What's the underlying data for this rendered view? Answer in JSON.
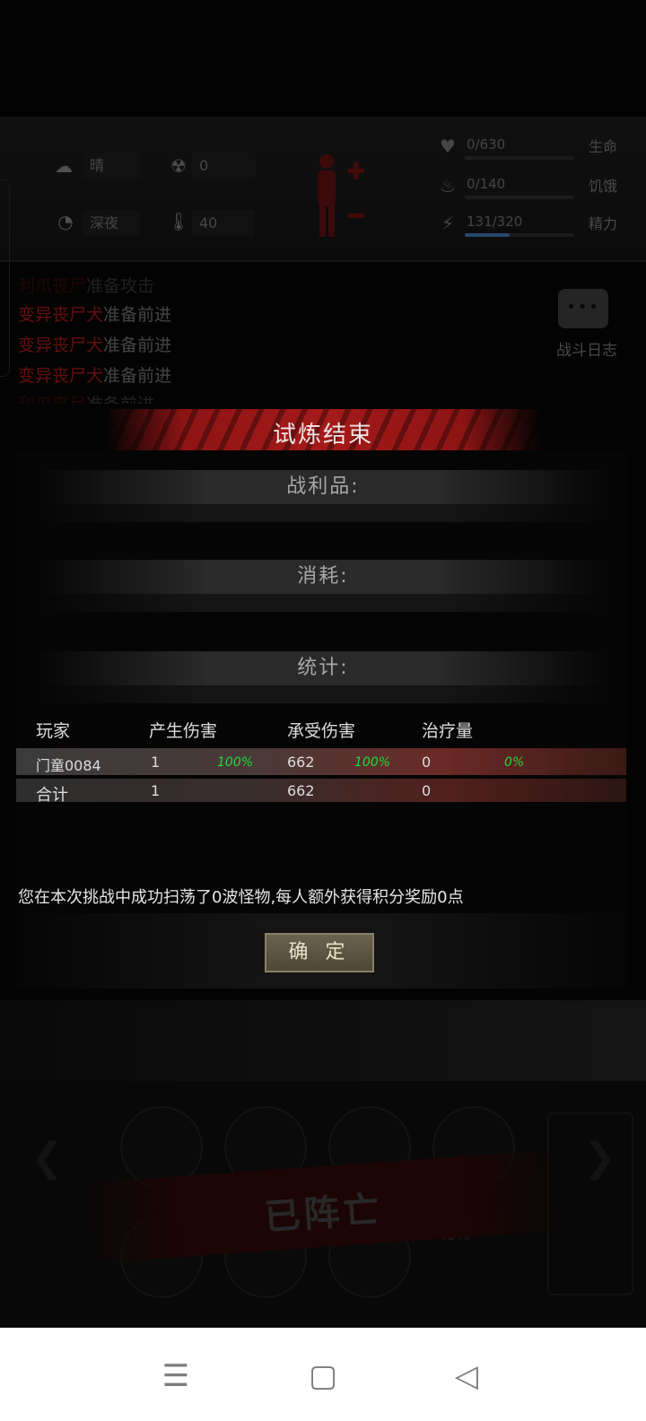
{
  "hud": {
    "weather": "晴",
    "radiation": "0",
    "time_of_day": "深夜",
    "temperature": "40",
    "stats": [
      {
        "value": "0/630",
        "label": "生命",
        "fill": 0
      },
      {
        "value": "0/140",
        "label": "饥饿",
        "fill": 0
      },
      {
        "value": "131/320",
        "label": "精力",
        "fill": 0.41
      }
    ]
  },
  "battle_log": {
    "lines": [
      {
        "name": "利爪丧尸",
        "text": "准备攻击"
      },
      {
        "name": "变异丧尸犬",
        "text": "准备前进"
      },
      {
        "name": "变异丧尸犬",
        "text": "准备前进"
      },
      {
        "name": "变异丧尸犬",
        "text": "准备前进"
      },
      {
        "name": "利爪丧尸",
        "text": "准备前进"
      }
    ],
    "button_label": "战斗日志"
  },
  "dialog": {
    "title": "试炼结束",
    "loot_label": "战利品:",
    "consume_label": "消耗:",
    "stats_label": "统计:",
    "table": {
      "headers": [
        "玩家",
        "产生伤害",
        "承受伤害",
        "治疗量"
      ],
      "rows": [
        {
          "player": "门童0084",
          "dmg": "1",
          "dmg_pct": "100%",
          "taken": "662",
          "taken_pct": "100%",
          "heal": "0",
          "heal_pct": "0%"
        },
        {
          "player": "合计",
          "dmg": "1",
          "taken": "662",
          "heal": "0"
        }
      ]
    },
    "notice": "您在本次挑战中成功扫荡了0波怪物,每人额外获得积分奖励0点",
    "confirm_label": "确 定"
  },
  "background": {
    "dead_banner": "已阵亡",
    "percent": "43%"
  },
  "navbar": {
    "menu": "☰",
    "home": "▢",
    "back": "◁"
  },
  "colors": {
    "accent_red": "#a51a1a",
    "percent_green": "#22d83a",
    "button_gold": "#6b634e"
  }
}
